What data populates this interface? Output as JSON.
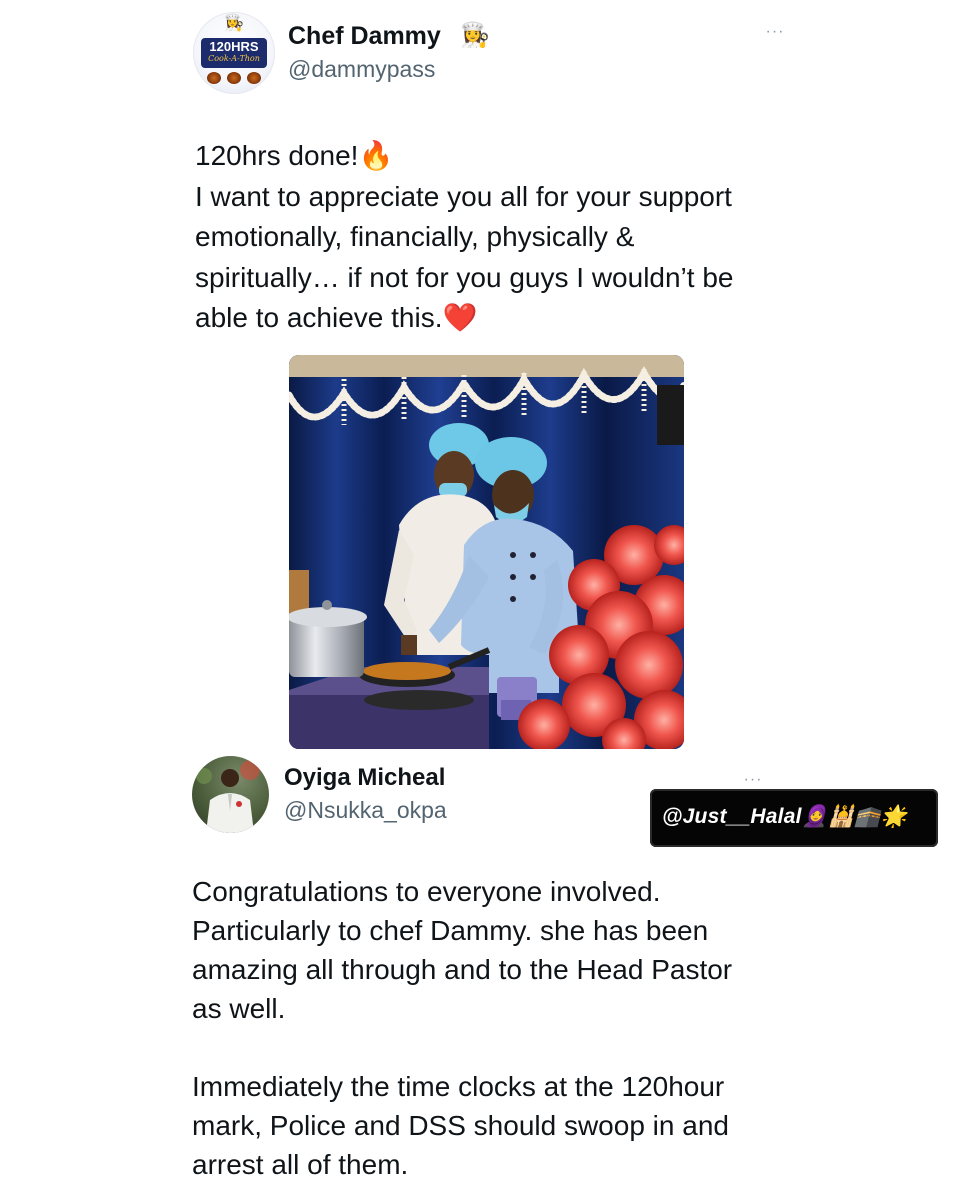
{
  "tweet1": {
    "avatar": {
      "brand_title": "120HRS",
      "brand_sub": "Cook-A-Thon"
    },
    "display_name": "Chef Dammy",
    "name_emoji": "👩‍🍳",
    "handle": "@dammypass",
    "more_label": "···",
    "text_lines": [
      "120hrs done!🔥",
      "I want to appreciate you all for your support",
      "emotionally, financially, physically &",
      "spiritually… if not for you guys I wouldn’t be",
      "able to achieve this.❤️"
    ],
    "photo_icon": "cooking-photo"
  },
  "tweet2": {
    "display_name": "Oyiga Micheal",
    "handle": "@Nsukka_okpa",
    "more_label": "···",
    "paragraph1_lines": [
      "Congratulations to everyone involved.",
      "Particularly to chef Dammy. she has been",
      "amazing all through and to the Head Pastor",
      "as well."
    ],
    "paragraph2_lines": [
      "Immediately the time clocks at the 120hour",
      "mark, Police and DSS should swoop in and",
      "arrest all of them."
    ]
  },
  "watermark": {
    "text": "@Just__Halal🧕🕌🕋🌟"
  },
  "colors": {
    "text": "#0f1419",
    "secondary": "#536471",
    "watermark_bg": "#050505"
  }
}
